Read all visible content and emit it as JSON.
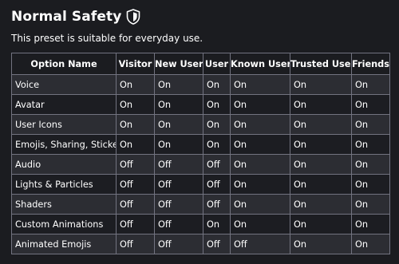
{
  "header": {
    "title": "Normal Safety",
    "icon": "shield-icon",
    "description": "This preset is suitable for everyday use."
  },
  "table": {
    "columns": [
      "Option Name",
      "Visitor",
      "New User",
      "User",
      "Known User",
      "Trusted User",
      "Friends"
    ],
    "rows": [
      {
        "name": "Voice",
        "values": [
          "On",
          "On",
          "On",
          "On",
          "On",
          "On"
        ]
      },
      {
        "name": "Avatar",
        "values": [
          "On",
          "On",
          "On",
          "On",
          "On",
          "On"
        ]
      },
      {
        "name": "User Icons",
        "values": [
          "On",
          "On",
          "On",
          "On",
          "On",
          "On"
        ]
      },
      {
        "name": "Emojis, Sharing, Stickers",
        "values": [
          "On",
          "On",
          "On",
          "On",
          "On",
          "On"
        ]
      },
      {
        "name": "Audio",
        "values": [
          "Off",
          "Off",
          "Off",
          "On",
          "On",
          "On"
        ]
      },
      {
        "name": "Lights & Particles",
        "values": [
          "Off",
          "Off",
          "Off",
          "On",
          "On",
          "On"
        ]
      },
      {
        "name": "Shaders",
        "values": [
          "Off",
          "Off",
          "Off",
          "On",
          "On",
          "On"
        ]
      },
      {
        "name": "Custom Animations",
        "values": [
          "Off",
          "Off",
          "On",
          "On",
          "On",
          "On"
        ]
      },
      {
        "name": "Animated Emojis",
        "values": [
          "Off",
          "Off",
          "Off",
          "Off",
          "On",
          "On"
        ]
      }
    ]
  },
  "colors": {
    "background": "#1b1c20",
    "row_alt": "#2c2d33",
    "row": "#1c1d22",
    "border": "#727380",
    "text": "#ffffff"
  }
}
